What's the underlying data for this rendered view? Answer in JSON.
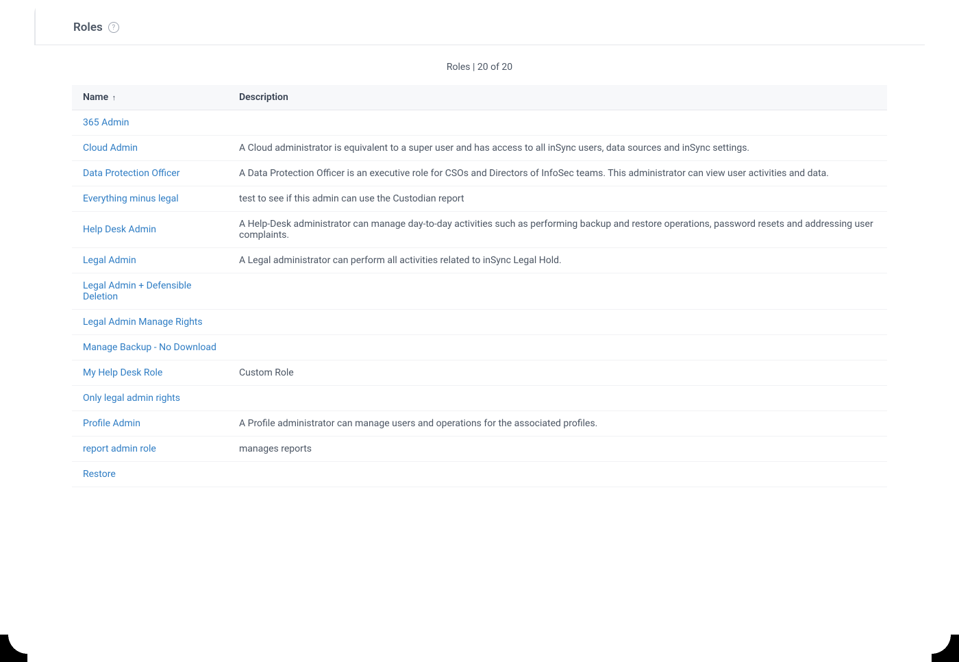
{
  "header": {
    "title": "Roles"
  },
  "table": {
    "count_label": "Roles | 20 of 20",
    "columns": {
      "name": "Name",
      "description": "Description"
    },
    "rows": [
      {
        "name": "365 Admin",
        "description": ""
      },
      {
        "name": "Cloud Admin",
        "description": "A Cloud administrator is equivalent to a super user and has access to all inSync users, data sources and inSync settings."
      },
      {
        "name": "Data Protection Officer",
        "description": "A Data Protection Officer is an executive role for CSOs and Directors of InfoSec teams. This administrator can view user activities and data."
      },
      {
        "name": "Everything minus legal",
        "description": "test to see if this admin can use the Custodian report"
      },
      {
        "name": "Help Desk Admin",
        "description": "A Help-Desk administrator can manage day-to-day activities such as performing backup and restore operations, password resets and addressing user complaints."
      },
      {
        "name": "Legal Admin",
        "description": "A Legal administrator can perform all activities related to inSync Legal Hold."
      },
      {
        "name": "Legal Admin + Defensible Deletion",
        "description": ""
      },
      {
        "name": "Legal Admin Manage Rights",
        "description": ""
      },
      {
        "name": "Manage Backup - No Download",
        "description": ""
      },
      {
        "name": "My Help Desk Role",
        "description": "Custom Role"
      },
      {
        "name": "Only legal admin rights",
        "description": ""
      },
      {
        "name": "Profile Admin",
        "description": "A Profile administrator can manage users and operations for the associated profiles."
      },
      {
        "name": "report admin role",
        "description": "manages reports"
      },
      {
        "name": "Restore",
        "description": ""
      }
    ]
  }
}
